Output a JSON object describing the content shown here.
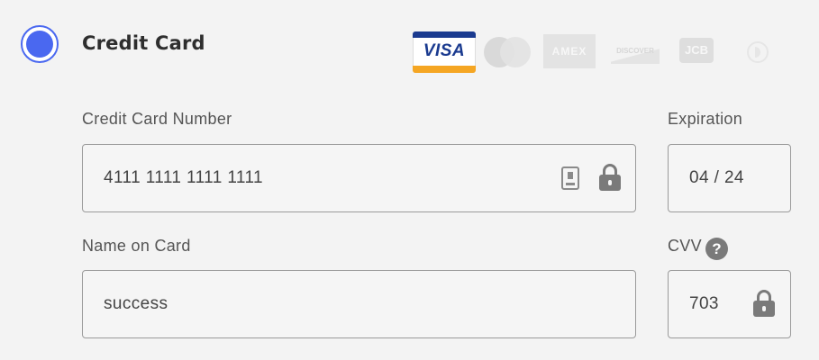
{
  "payment_method": {
    "label": "Credit Card",
    "selected": true
  },
  "card_brands": [
    {
      "name": "VISA",
      "active": true
    },
    {
      "name": "Mastercard",
      "active": false
    },
    {
      "name": "AMEX",
      "active": false
    },
    {
      "name": "DISCOVER",
      "active": false
    },
    {
      "name": "JCB",
      "active": false
    },
    {
      "name": "Diners Club",
      "active": false
    }
  ],
  "fields": {
    "card_number": {
      "label": "Credit Card Number",
      "value": "4111 1111 1111 1111"
    },
    "expiration": {
      "label": "Expiration",
      "value": "04 / 24"
    },
    "name_on_card": {
      "label": "Name on Card",
      "value": "success"
    },
    "cvv": {
      "label": "CVV",
      "value": "703",
      "help_glyph": "?"
    }
  },
  "colors": {
    "accent": "#4a68f0",
    "visa_blue": "#1a3a8f",
    "visa_gold": "#f5a623"
  }
}
